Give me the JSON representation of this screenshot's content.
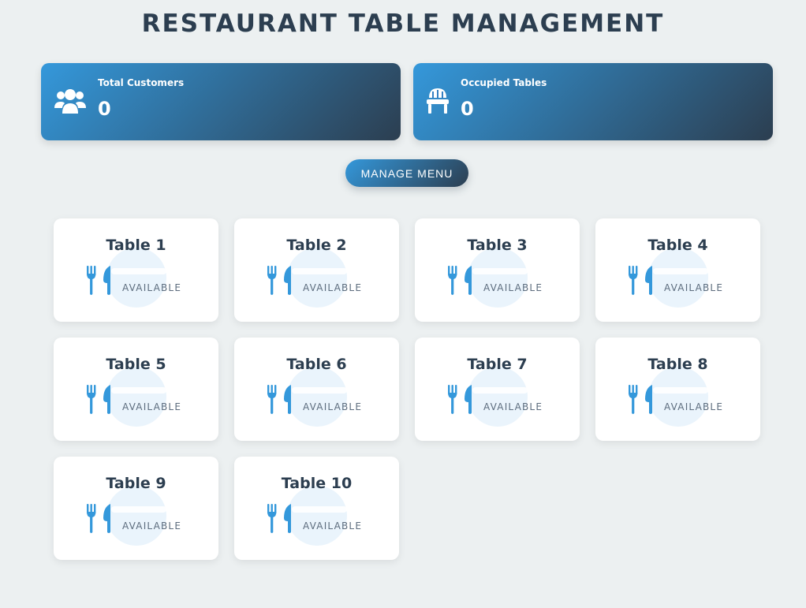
{
  "header": {
    "title": "RESTAURANT TABLE MANAGEMENT"
  },
  "stats": {
    "customers": {
      "label": "Total Customers",
      "value": "0",
      "icon": "users-icon"
    },
    "tables": {
      "label": "Occupied Tables",
      "value": "0",
      "icon": "chair-icon"
    }
  },
  "actions": {
    "manage_menu_label": "MANAGE MENU"
  },
  "tables": [
    {
      "name": "Table 1",
      "status": "AVAILABLE"
    },
    {
      "name": "Table 2",
      "status": "AVAILABLE"
    },
    {
      "name": "Table 3",
      "status": "AVAILABLE"
    },
    {
      "name": "Table 4",
      "status": "AVAILABLE"
    },
    {
      "name": "Table 5",
      "status": "AVAILABLE"
    },
    {
      "name": "Table 6",
      "status": "AVAILABLE"
    },
    {
      "name": "Table 7",
      "status": "AVAILABLE"
    },
    {
      "name": "Table 8",
      "status": "AVAILABLE"
    },
    {
      "name": "Table 9",
      "status": "AVAILABLE"
    },
    {
      "name": "Table 10",
      "status": "AVAILABLE"
    }
  ],
  "colors": {
    "accent": "#3498db",
    "dark": "#2c3e50",
    "background": "#ecf0f1",
    "status_available": "#5d6d7e"
  }
}
